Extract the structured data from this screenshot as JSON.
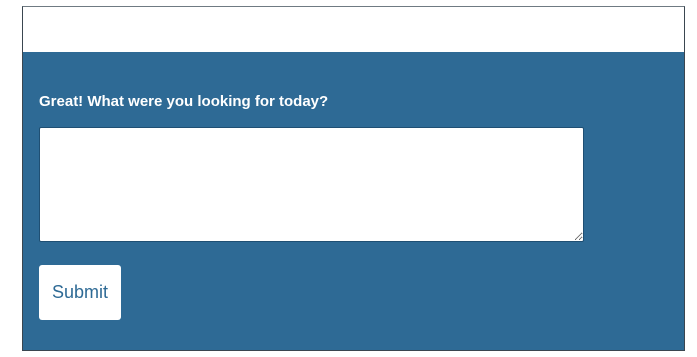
{
  "feedback": {
    "question": "Great! What were you looking for today?",
    "answer_value": "",
    "submit_label": "Submit"
  },
  "colors": {
    "panel_background": "#2e6a95",
    "text_on_panel": "#ffffff",
    "button_background": "#ffffff",
    "button_text": "#2e6a95"
  }
}
